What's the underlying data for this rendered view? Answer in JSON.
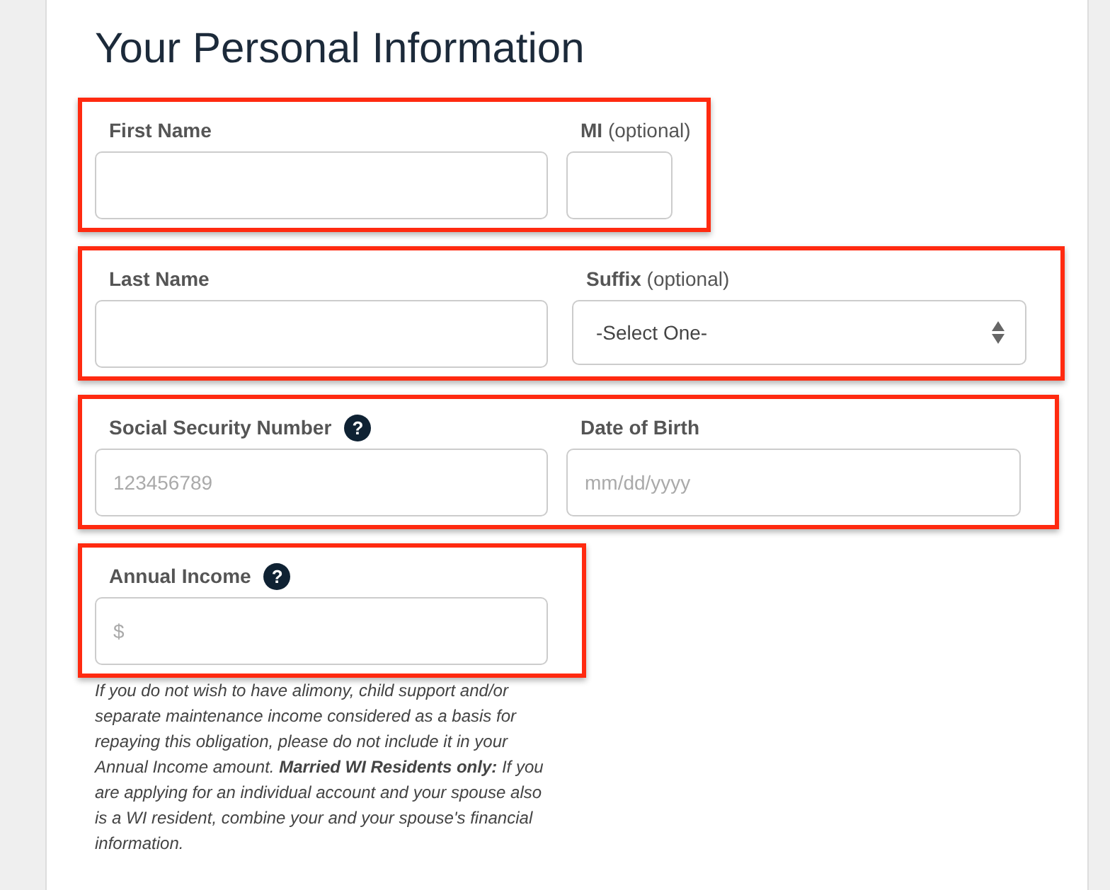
{
  "title": "Your Personal Information",
  "groups": [
    {
      "highlighted": true,
      "fields": [
        {
          "kind": "text",
          "label": "First Name"
        },
        {
          "kind": "initial",
          "label": "MI",
          "note": "(optional)"
        }
      ]
    },
    {
      "highlighted": true,
      "fields": [
        {
          "kind": "text",
          "label": "Last Name"
        },
        {
          "kind": "select",
          "label": "Suffix",
          "note": "(optional)",
          "value": "-Select One-"
        }
      ]
    },
    {
      "highlighted": true,
      "fields": [
        {
          "kind": "text",
          "label": "Social Security Number",
          "help": "?",
          "placeholder": "123456789"
        },
        {
          "kind": "text",
          "label": "Date of Birth",
          "placeholder": "mm/dd/yyyy"
        }
      ]
    },
    {
      "highlighted": true,
      "fields": [
        {
          "kind": "text",
          "label": "Annual Income",
          "help": "?",
          "placeholder": "$"
        }
      ]
    }
  ],
  "help_text": "*If you do not wish to have alimony, child support and/or separate maintenance income considered as a basis for repaying this obligation, please do not include it in your Annual Income amount.* **Married WI Residents only:** *If you are applying for an individual account and your spouse also is a WI resident, combine your and your spouse's financial information.*"
}
